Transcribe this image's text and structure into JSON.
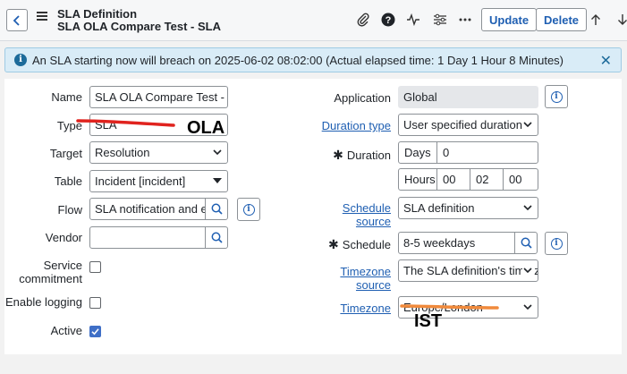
{
  "header": {
    "title_line1": "SLA Definition",
    "title_line2": "SLA OLA Compare Test - SLA",
    "update_label": "Update",
    "delete_label": "Delete"
  },
  "alert": {
    "message": "An SLA starting now will breach on 2025-06-02 08:02:00 (Actual elapsed time: 1 Day 1 Hour 8 Minutes)"
  },
  "left": {
    "name_label": "Name",
    "name_value": "SLA OLA Compare Test - SLA",
    "type_label": "Type",
    "type_value": "SLA",
    "target_label": "Target",
    "target_value": "Resolution",
    "table_label": "Table",
    "table_value": "Incident [incident]",
    "flow_label": "Flow",
    "flow_value": "SLA notification and esc",
    "vendor_label": "Vendor",
    "vendor_value": "",
    "service_commitment_label_1": "Service",
    "service_commitment_label_2": "commitment",
    "service_commitment_checked": false,
    "enable_logging_label": "Enable logging",
    "enable_logging_checked": false,
    "active_label": "Active",
    "active_checked": true
  },
  "right": {
    "application_label": "Application",
    "application_value": "Global",
    "duration_type_label": "Duration type",
    "duration_type_value": "User specified duration",
    "duration_label": "Duration",
    "days_label": "Days",
    "days_value": "0",
    "hours_label": "Hours",
    "hours_value": "00",
    "minutes_value": "02",
    "seconds_value": "00",
    "schedule_source_label_1": "Schedule",
    "schedule_source_label_2": "source",
    "schedule_source_value": "SLA definition",
    "schedule_label": "Schedule",
    "schedule_value": "8-5 weekdays",
    "timezone_source_label_1": "Timezone",
    "timezone_source_label_2": "source",
    "timezone_source_value": "The SLA definition's time z",
    "timezone_label": "Timezone",
    "timezone_value": "Europe/London"
  },
  "annotations": {
    "ola_text": "OLA",
    "ist_text": "IST",
    "red_color": "#e0231e",
    "orange_color": "#f08a3c"
  },
  "icons": {
    "back": "chevron-left-icon",
    "menu": "hamburger-icon",
    "attach": "paperclip-icon",
    "help": "question-icon",
    "activity": "pulse-icon",
    "settings": "sliders-icon",
    "more": "ellipsis-icon",
    "up": "arrow-up-icon",
    "down": "arrow-down-icon"
  },
  "colors": {
    "accent": "#1f5fb2",
    "alert_bg": "#d9ecf7",
    "checkbox_checked": "#3f6fc7"
  }
}
